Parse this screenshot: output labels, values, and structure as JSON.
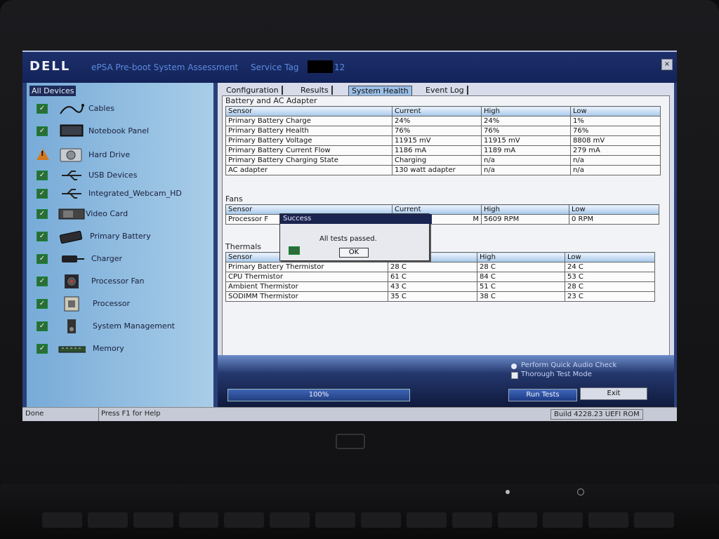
{
  "titlebar": {
    "logo": "DELL",
    "app_title": "ePSA Pre-boot System Assessment",
    "service_tag_label": "Service Tag",
    "service_tag_value": "12",
    "close": "×"
  },
  "sidebar": {
    "header": "All Devices",
    "items": [
      {
        "label": "Cables",
        "status": "pass"
      },
      {
        "label": "Notebook Panel",
        "status": "pass"
      },
      {
        "label": "Hard Drive",
        "status": "warning"
      },
      {
        "label": "USB Devices",
        "status": "pass"
      },
      {
        "label": "Integrated_Webcam_HD",
        "status": "pass"
      },
      {
        "label": "Video Card",
        "status": "pass"
      },
      {
        "label": "Primary Battery",
        "status": "pass"
      },
      {
        "label": "Charger",
        "status": "pass"
      },
      {
        "label": "Processor Fan",
        "status": "pass"
      },
      {
        "label": "Processor",
        "status": "pass"
      },
      {
        "label": "System Management",
        "status": "pass"
      },
      {
        "label": "Memory",
        "status": "pass"
      }
    ]
  },
  "tabs": [
    "Configuration",
    "Results",
    "System Health",
    "Event Log"
  ],
  "active_tab": "System Health",
  "battery": {
    "title": "Battery and AC Adapter",
    "headers": [
      "Sensor",
      "Current",
      "High",
      "Low"
    ],
    "rows": [
      [
        "Primary Battery Charge",
        "24%",
        "24%",
        "1%"
      ],
      [
        "Primary Battery Health",
        "76%",
        "76%",
        "76%"
      ],
      [
        "Primary Battery Voltage",
        "11915 mV",
        "11915 mV",
        "8808 mV"
      ],
      [
        "Primary Battery Current Flow",
        "1186 mA",
        "1189 mA",
        "279 mA"
      ],
      [
        "Primary Battery Charging State",
        "Charging",
        "n/a",
        "n/a"
      ],
      [
        "AC adapter",
        "130 watt adapter",
        "n/a",
        "n/a"
      ]
    ]
  },
  "fans": {
    "title": "Fans",
    "headers": [
      "Sensor",
      "Current",
      "High",
      "Low"
    ],
    "rows": [
      [
        "Processor F",
        "M",
        "5609 RPM",
        "0 RPM"
      ]
    ]
  },
  "thermals": {
    "title": "Thermals",
    "headers": [
      "Sensor",
      "",
      "High",
      "Low"
    ],
    "rows": [
      [
        "Primary Battery Thermistor",
        "28 C",
        "28 C",
        "24 C"
      ],
      [
        "CPU Thermistor",
        "61 C",
        "84 C",
        "53 C"
      ],
      [
        "Ambient Thermistor",
        "43 C",
        "51 C",
        "28 C"
      ],
      [
        "SODIMM Thermistor",
        "35 C",
        "38 C",
        "23 C"
      ]
    ]
  },
  "dialog": {
    "title": "Success",
    "message": "All tests passed.",
    "ok": "OK"
  },
  "options": {
    "quick_audio": "Perform Quick Audio Check",
    "thorough": "Thorough Test Mode"
  },
  "progress": {
    "label": "100%",
    "value": 1.0
  },
  "buttons": {
    "run": "Run Tests",
    "exit": "Exit"
  },
  "status": {
    "left": "Done",
    "help": "Press F1 for Help",
    "build": "Build  4228.23 UEFI ROM"
  },
  "colors": {
    "titlebar": "#13235a",
    "accent": "#5d8be0",
    "pass": "#2d6b3a",
    "warning": "#d3781f"
  }
}
